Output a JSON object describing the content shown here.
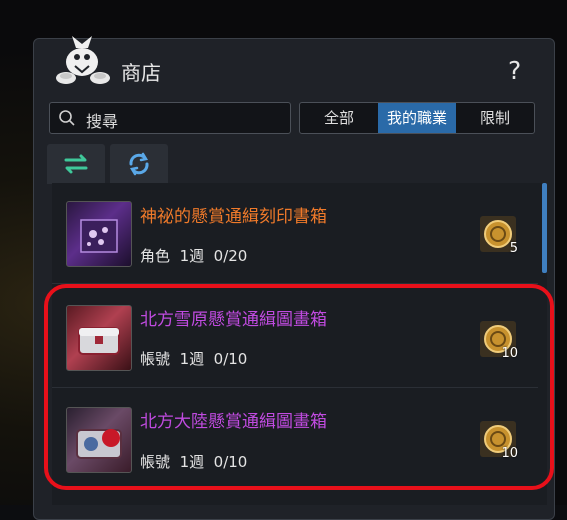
{
  "shop": {
    "title": "商店",
    "help": "?"
  },
  "search": {
    "value": "搜尋"
  },
  "filters": [
    "全部",
    "我的職業",
    "限制"
  ],
  "active_filter": "我的職業",
  "tabs": [
    "exchange-icon",
    "refresh-icon"
  ],
  "items": [
    {
      "name": "神祕的懸賞通緝刻印書箱",
      "scope": "角色",
      "period": "1週",
      "limit": "0/20",
      "cost": "5",
      "name_color": "#f07a2a"
    },
    {
      "name": "北方雪原懸賞通緝圖畫箱",
      "scope": "帳號",
      "period": "1週",
      "limit": "0/10",
      "cost": "10",
      "name_color": "#c04be0"
    },
    {
      "name": "北方大陸懸賞通緝圖畫箱",
      "scope": "帳號",
      "period": "1週",
      "limit": "0/10",
      "cost": "10",
      "name_color": "#c04be0"
    }
  ],
  "colors": {
    "accent": "#2a6aa8",
    "highlight": "#e8101a"
  }
}
